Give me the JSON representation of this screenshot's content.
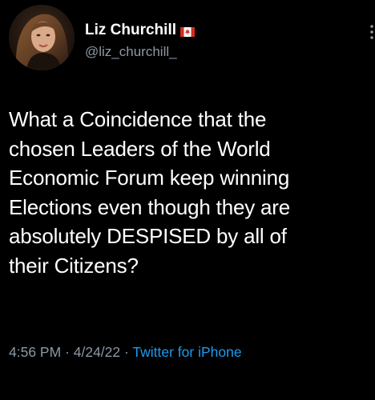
{
  "user": {
    "display_name": "Liz Churchill",
    "handle": "@liz_churchill_",
    "flag_icon": "canada-flag-icon",
    "avatar_icon": "profile-photo"
  },
  "tweet": {
    "text": "What a Coincidence that the\nchosen Leaders of the World\nEconomic Forum keep winning\nElections even though they are\nabsolutely DESPISED by all of\ntheir Citizens?"
  },
  "meta": {
    "time": "4:56 PM",
    "separator_1": " · ",
    "date": "4/24/22",
    "separator_2": " · ",
    "source": "Twitter for iPhone"
  },
  "colors": {
    "background": "#000000",
    "text": "#ffffff",
    "secondary": "#8b98a5",
    "link": "#1d9bf0",
    "flag_red": "#d52b1e"
  }
}
